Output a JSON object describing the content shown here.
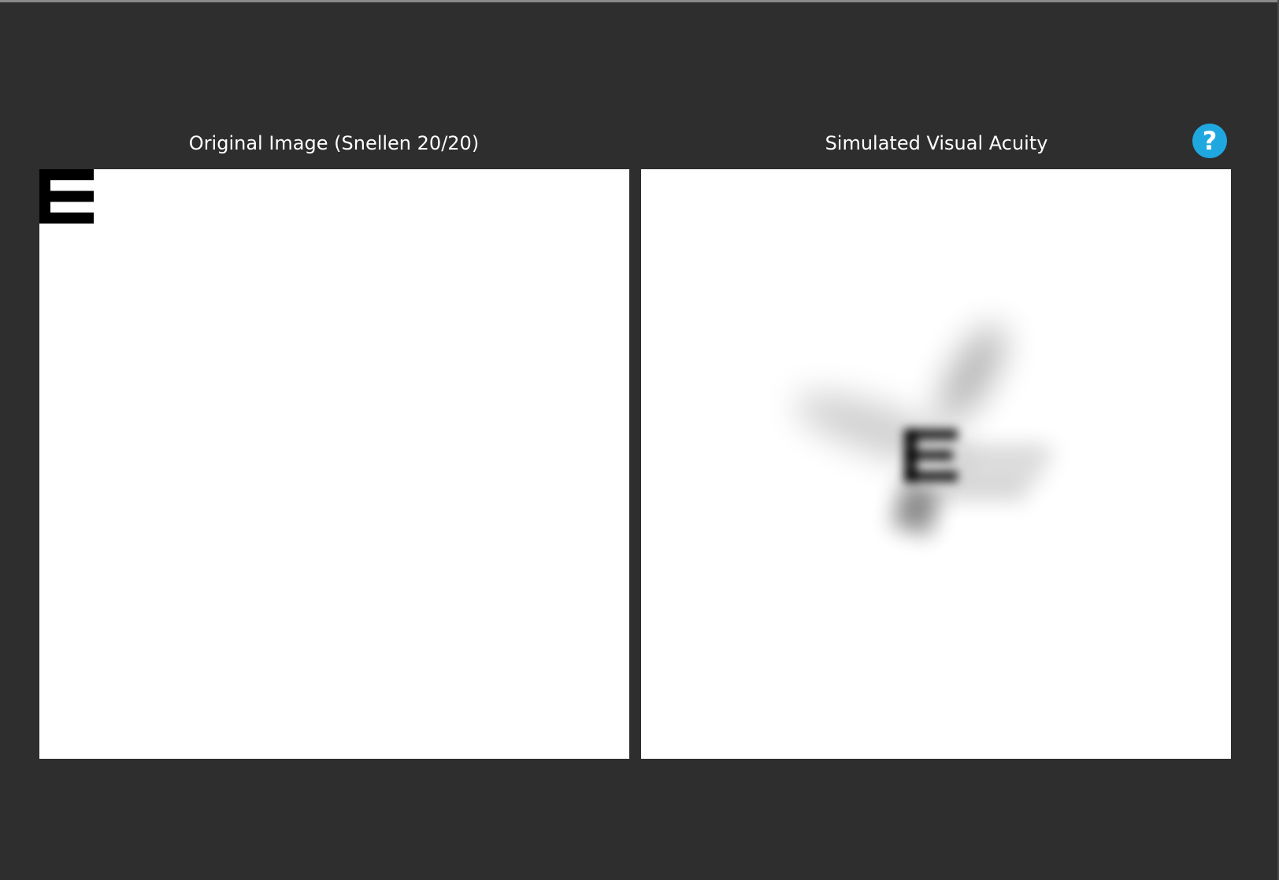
{
  "panels": {
    "original": {
      "title": "Original Image (Snellen 20/20)",
      "optotype": "E"
    },
    "simulated": {
      "title": "Simulated Visual Acuity",
      "optotype": "E"
    }
  },
  "help": {
    "icon": "question-mark-icon",
    "label": "?"
  },
  "colors": {
    "background": "#2e2e2e",
    "panel": "#ffffff",
    "help_button": "#1fa8e0",
    "text": "#ffffff"
  }
}
